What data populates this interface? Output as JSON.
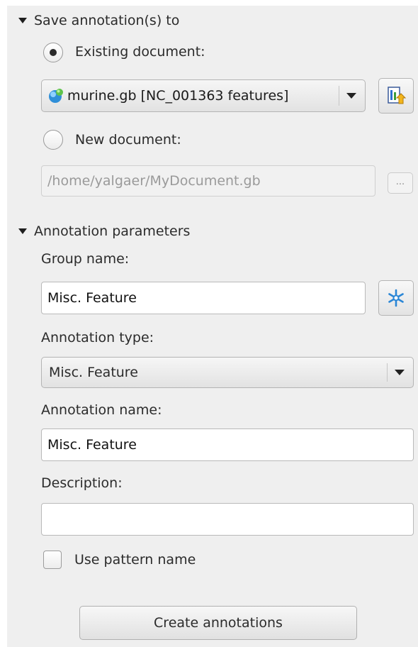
{
  "save_section": {
    "header": "Save annotation(s) to",
    "existing_label": "Existing document:",
    "existing_selected": true,
    "document_combo_value": "murine.gb [NC_001363 features]",
    "new_label": "New document:",
    "new_path": "/home/yalgaer/MyDocument.gb",
    "browse_label": "..."
  },
  "params_section": {
    "header": "Annotation parameters",
    "group_name_label": "Group name:",
    "group_name_value": "Misc. Feature",
    "annotation_type_label": "Annotation type:",
    "annotation_type_value": "Misc. Feature",
    "annotation_name_label": "Annotation name:",
    "annotation_name_value": "Misc. Feature",
    "description_label": "Description:",
    "description_value": "",
    "use_pattern_label": "Use pattern name",
    "use_pattern_checked": false
  },
  "create_button_label": "Create annotations",
  "icons": {
    "document": "document-sphere-icon",
    "project": "project-view-icon",
    "group_select": "snowflake-select-icon"
  }
}
